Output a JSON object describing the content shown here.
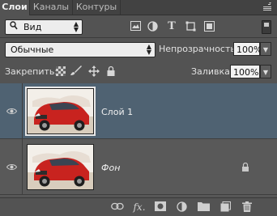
{
  "tabs": [
    {
      "label": "Слои",
      "active": true
    },
    {
      "label": "Каналы",
      "active": false
    },
    {
      "label": "Контуры",
      "active": false
    }
  ],
  "filter": {
    "kind_label": "Вид",
    "icons": [
      "image-icon",
      "adjustment-icon",
      "type-icon",
      "shape-icon",
      "smart-object-icon"
    ]
  },
  "blend": {
    "mode": "Обычные",
    "opacity_label": "Непрозрачность:",
    "opacity_value": "100%",
    "lock_label": "Закрепить:",
    "fill_label": "Заливка:",
    "fill_value": "100%"
  },
  "layers": [
    {
      "name": "Слой 1",
      "selected": true,
      "locked": false,
      "italic": false
    },
    {
      "name": "Фон",
      "selected": false,
      "locked": true,
      "italic": true
    }
  ],
  "bottom_icons": [
    "link-icon",
    "fx-icon",
    "mask-icon",
    "adjustment-layer-icon",
    "folder-icon",
    "new-layer-icon",
    "trash-icon"
  ],
  "colors": {
    "panel_bg": "#535353",
    "selected_layer": "#4f6272",
    "car_red": "#c8231f"
  }
}
